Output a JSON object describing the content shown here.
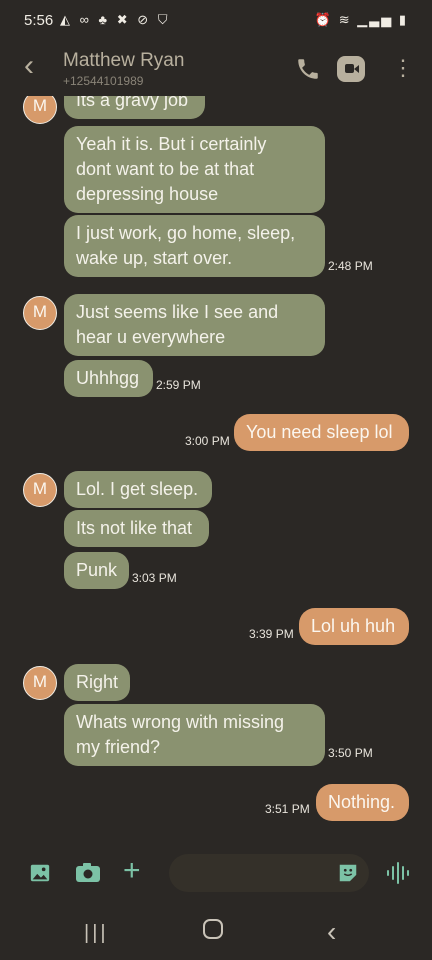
{
  "status": {
    "time": "5:56"
  },
  "header": {
    "contact_name": "Matthew Ryan",
    "contact_number": "+12544101989"
  },
  "messages": [
    {
      "dir": "in",
      "text": "Its a gravy job"
    },
    {
      "dir": "in",
      "text": "Yeah it is. But i certainly\ndont want to be at that\ndepressing house"
    },
    {
      "dir": "in",
      "text": "I just work, go home, sleep,\nwake up, start over.",
      "time": "2:48 PM"
    },
    {
      "dir": "in",
      "text": "Just seems like I see and\nhear u everywhere",
      "avatar": "M"
    },
    {
      "dir": "in",
      "text": "Uhhhgg",
      "time": "2:59 PM"
    },
    {
      "dir": "out",
      "text": "You need sleep lol",
      "time": "3:00 PM"
    },
    {
      "dir": "in",
      "text": "Lol. I get sleep.",
      "avatar": "M"
    },
    {
      "dir": "in",
      "text": "Its not like that"
    },
    {
      "dir": "in",
      "text": "Punk",
      "time": "3:03 PM"
    },
    {
      "dir": "out",
      "text": "Lol uh huh",
      "time": "3:39 PM"
    },
    {
      "dir": "in",
      "text": "Right",
      "avatar": "M"
    },
    {
      "dir": "in",
      "text": "Whats wrong with missing\nmy friend?",
      "time": "3:50 PM"
    },
    {
      "dir": "out",
      "text": "Nothing.",
      "time": "3:51 PM"
    }
  ],
  "avatar_letter": "M",
  "colors": {
    "incoming": "#8a9270",
    "outgoing": "#d79a6a",
    "background": "#2b2825",
    "accent": "#7cc2a6"
  }
}
